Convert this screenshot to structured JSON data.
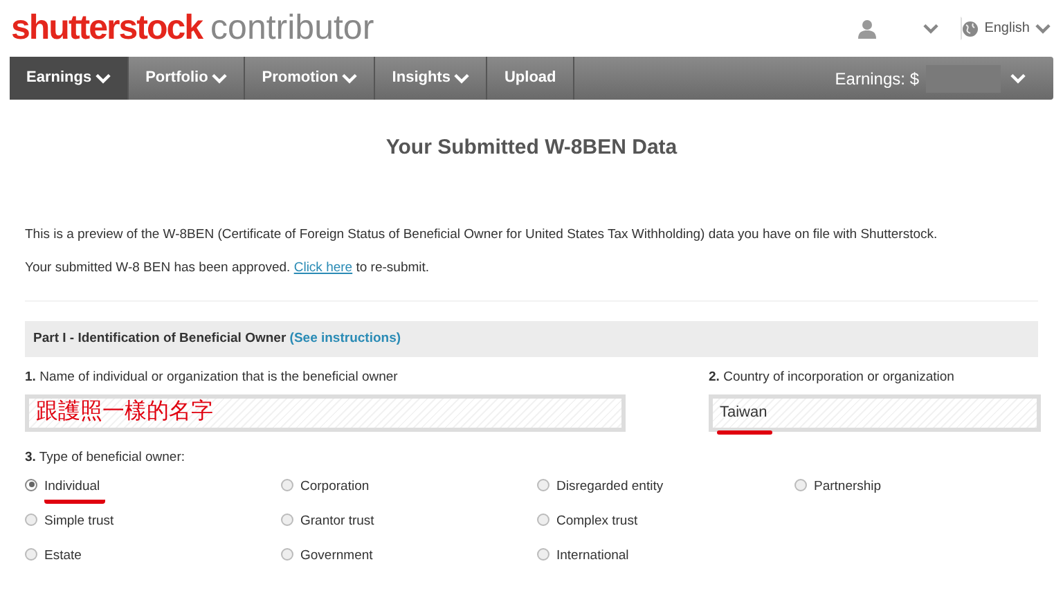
{
  "header": {
    "logo_brand": "shutterstock",
    "logo_product": "contributor",
    "language": "English"
  },
  "nav": {
    "items": [
      {
        "label": "Earnings",
        "dropdown": true,
        "selected": true
      },
      {
        "label": "Portfolio",
        "dropdown": true,
        "selected": false
      },
      {
        "label": "Promotion",
        "dropdown": true,
        "selected": false
      },
      {
        "label": "Insights",
        "dropdown": true,
        "selected": false
      },
      {
        "label": "Upload",
        "dropdown": false,
        "selected": false
      }
    ],
    "earnings_label": "Earnings: $"
  },
  "page_title": "Your Submitted W-8BEN Data",
  "intro": "This is a preview of the W-8BEN (Certificate of Foreign Status of Beneficial Owner for United States Tax Withholding) data you have on file with Shutterstock.",
  "approval": {
    "before": "Your submitted W-8 BEN has been approved.",
    "link": "Click here",
    "after": "to re-submit."
  },
  "section": {
    "title": "Part I - Identification of Beneficial Owner",
    "link": "(See instructions)"
  },
  "fields": [
    {
      "number": "1.",
      "label": "Name of individual or organization that is the beneficial owner",
      "value": "跟護照一樣的名字",
      "annotated": false
    },
    {
      "number": "2.",
      "label": "Country of incorporation or organization",
      "value": "Taiwan",
      "annotated": true
    }
  ],
  "owner_type": {
    "number": "3.",
    "label": "Type of beneficial owner:",
    "rows": [
      [
        {
          "label": "Individual",
          "selected": true,
          "annotated": true
        },
        {
          "label": "Corporation",
          "selected": false,
          "annotated": false
        },
        {
          "label": "Disregarded entity",
          "selected": false,
          "annotated": false
        },
        {
          "label": "Partnership",
          "selected": false,
          "annotated": false
        }
      ],
      [
        {
          "label": "Simple trust",
          "selected": false,
          "annotated": false
        },
        {
          "label": "Grantor trust",
          "selected": false,
          "annotated": false
        },
        {
          "label": "Complex trust",
          "selected": false,
          "annotated": false
        }
      ],
      [
        {
          "label": "Estate",
          "selected": false,
          "annotated": false
        },
        {
          "label": "Government",
          "selected": false,
          "annotated": false
        },
        {
          "label": "International",
          "selected": false,
          "annotated": false
        }
      ]
    ]
  }
}
